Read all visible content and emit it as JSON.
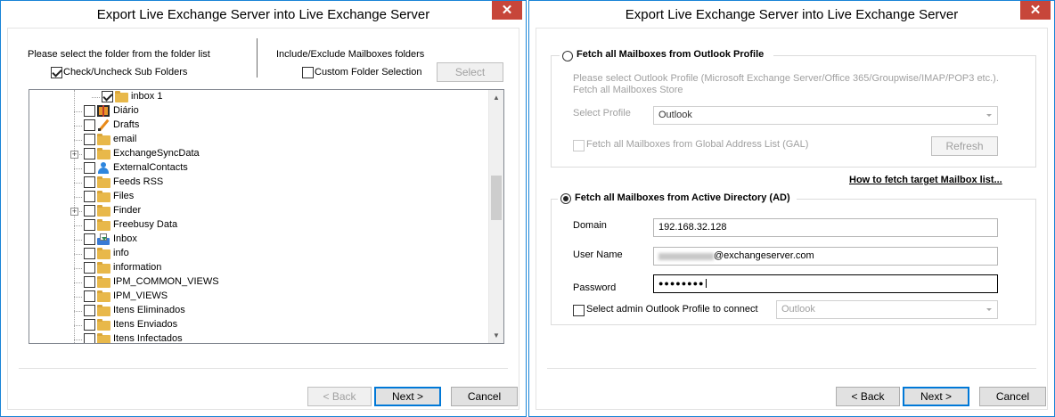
{
  "window_left": {
    "title": "Export  Live Exchange Server  into Live Exchange Server",
    "close_label": "✕",
    "folder_prompt": "Please select the folder from the folder list",
    "check_sub_folders_label": "Check/Uncheck Sub Folders",
    "include_exclude_label": "Include/Exclude Mailboxes folders",
    "custom_folder_label": "Custom Folder Selection",
    "select_button": "Select",
    "tree_items": [
      {
        "label": "inbox 1",
        "checked": true,
        "icon": "folder-icon"
      },
      {
        "label": "Diário",
        "checked": false,
        "icon": "journal-icon"
      },
      {
        "label": "Drafts",
        "checked": false,
        "icon": "pencil-icon"
      },
      {
        "label": "email",
        "checked": false,
        "icon": "folder-icon"
      },
      {
        "label": "ExchangeSyncData",
        "checked": false,
        "icon": "folder-icon",
        "expandable": true
      },
      {
        "label": "ExternalContacts",
        "checked": false,
        "icon": "contact-icon"
      },
      {
        "label": "Feeds RSS",
        "checked": false,
        "icon": "folder-icon"
      },
      {
        "label": "Files",
        "checked": false,
        "icon": "folder-icon"
      },
      {
        "label": "Finder",
        "checked": false,
        "icon": "folder-icon",
        "expandable": true
      },
      {
        "label": "Freebusy Data",
        "checked": false,
        "icon": "folder-icon"
      },
      {
        "label": "Inbox",
        "checked": false,
        "icon": "inbox-icon"
      },
      {
        "label": "info",
        "checked": false,
        "icon": "folder-icon"
      },
      {
        "label": "information",
        "checked": false,
        "icon": "folder-icon"
      },
      {
        "label": "IPM_COMMON_VIEWS",
        "checked": false,
        "icon": "folder-icon"
      },
      {
        "label": "IPM_VIEWS",
        "checked": false,
        "icon": "folder-icon"
      },
      {
        "label": "Itens Eliminados",
        "checked": false,
        "icon": "folder-icon"
      },
      {
        "label": "Itens Enviados",
        "checked": false,
        "icon": "folder-icon"
      },
      {
        "label": "Itens Infectados",
        "checked": false,
        "icon": "folder-icon"
      }
    ],
    "back_button": "< Back",
    "next_button": "Next >",
    "cancel_button": "Cancel"
  },
  "window_right": {
    "title": "Export  Live Exchange Server  into Live Exchange Server",
    "close_label": "✕",
    "outlook_profile_option": "Fetch all Mailboxes from Outlook Profile",
    "outlook_profile_help_1": "Please select Outlook Profile (Microsoft Exchange Server/Office 365/Groupwise/IMAP/POP3 etc.).",
    "outlook_profile_help_2": "Fetch all Mailboxes Store",
    "select_profile_label": "Select Profile",
    "select_profile_value": "Outlook",
    "gal_label": "Fetch all Mailboxes from Global Address List (GAL)",
    "refresh_button": "Refresh",
    "how_to_link": "How to fetch target Mailbox list...",
    "ad_option": "Fetch all Mailboxes from Active Directory (AD)",
    "domain_label": "Domain",
    "domain_value": "192.168.32.128",
    "username_label": "User Name",
    "username_value": "@exchangeserver.com",
    "password_label": "Password",
    "password_value": "●●●●●●●●",
    "admin_profile_label": "Select admin Outlook Profile to connect",
    "admin_profile_value": "Outlook",
    "back_button": "< Back",
    "next_button": "Next >",
    "cancel_button": "Cancel"
  }
}
